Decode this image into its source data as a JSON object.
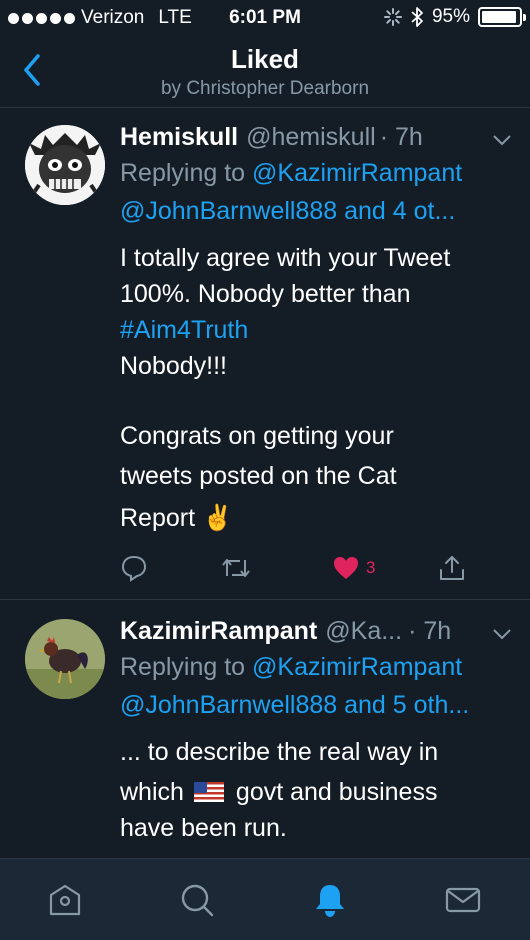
{
  "status_bar": {
    "carrier": "Verizon",
    "network": "LTE",
    "time": "6:01 PM",
    "battery": "95%",
    "battery_level": 0.95
  },
  "nav": {
    "title": "Liked",
    "subtitle": "by Christopher Dearborn"
  },
  "tweets": [
    {
      "name": "Hemiskull",
      "handle": "@hemiskull",
      "time": "· 7h",
      "replying_prefix": "Replying to",
      "replying_to_1": "@KazimirRampant",
      "replying_to_2": "@JohnBarnwell888 and 4 ot...",
      "line1": "I totally agree with your Tweet",
      "line2": "100%. Nobody better than",
      "hashtag": "#Aim4Truth",
      "line3": "Nobody!!!",
      "line4": "Congrats on getting your",
      "line5": "tweets posted on the Cat",
      "line6": "Report ✌️",
      "like_count": "3"
    },
    {
      "name": "KazimirRampant",
      "handle": "@Ka...",
      "time": "· 7h",
      "replying_prefix": "Replying to",
      "replying_to_1": "@KazimirRampant",
      "replying_to_2": "@JohnBarnwell888 and 5 oth...",
      "line1": "... to describe the real way in",
      "line2_a": "which",
      "line2_b": "govt and business",
      "line3": "have been run."
    }
  ],
  "colors": {
    "background": "#141d26",
    "accent": "#1da1f2",
    "muted": "#8899a6",
    "like": "#e0245e"
  },
  "tabs": [
    "home-icon",
    "search-icon",
    "notifications-icon",
    "messages-icon"
  ]
}
